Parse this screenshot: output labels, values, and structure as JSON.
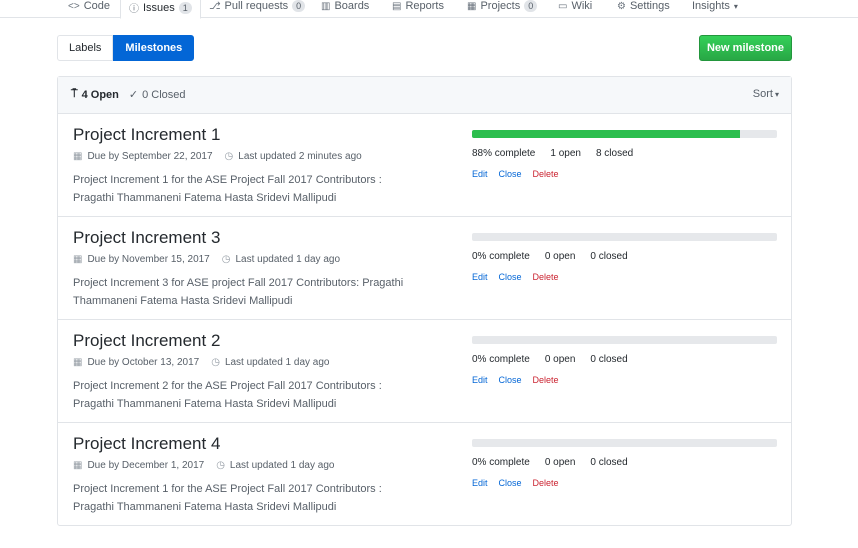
{
  "nav": {
    "tabs": [
      {
        "icon": "<>",
        "label": "Code",
        "counter": ""
      },
      {
        "icon": "ⓘ",
        "label": "Issues",
        "counter": "1"
      },
      {
        "icon": "⎇",
        "label": "Pull requests",
        "counter": "0"
      },
      {
        "icon": "▥",
        "label": "Boards",
        "counter": ""
      },
      {
        "icon": "▤",
        "label": "Reports",
        "counter": ""
      },
      {
        "icon": "▦",
        "label": "Projects",
        "counter": "0"
      },
      {
        "icon": "▭",
        "label": "Wiki",
        "counter": ""
      },
      {
        "icon": "⚙",
        "label": "Settings",
        "counter": ""
      },
      {
        "icon": "",
        "label": "Insights",
        "counter": ""
      }
    ]
  },
  "subnav": {
    "labels": "Labels",
    "milestones": "Milestones"
  },
  "new_milestone": "New milestone",
  "header": {
    "open": "4 Open",
    "closed": "0 Closed",
    "sort": "Sort"
  },
  "milestones": [
    {
      "title": "Project Increment 1",
      "due": "Due by September 22, 2017",
      "updated": "Last updated 2 minutes ago",
      "desc": "Project Increment 1 for the ASE Project Fall 2017 Contributors : Pragathi Thammaneni Fatema Hasta Sridevi Mallipudi",
      "progress": 88,
      "complete": "88% complete",
      "open": "1 open",
      "closed": "8 closed",
      "edit": "Edit",
      "close": "Close",
      "delete": "Delete"
    },
    {
      "title": "Project Increment 3",
      "due": "Due by November 15, 2017",
      "updated": "Last updated 1 day ago",
      "desc": "Project Increment 3 for ASE project Fall 2017 Contributors: Pragathi Thammaneni Fatema Hasta Sridevi Mallipudi",
      "progress": 0,
      "complete": "0% complete",
      "open": "0 open",
      "closed": "0 closed",
      "edit": "Edit",
      "close": "Close",
      "delete": "Delete"
    },
    {
      "title": "Project Increment 2",
      "due": "Due by October 13, 2017",
      "updated": "Last updated 1 day ago",
      "desc": "Project Increment 2 for the ASE Project Fall 2017 Contributors : Pragathi Thammaneni Fatema Hasta Sridevi Mallipudi",
      "progress": 0,
      "complete": "0% complete",
      "open": "0 open",
      "closed": "0 closed",
      "edit": "Edit",
      "close": "Close",
      "delete": "Delete"
    },
    {
      "title": "Project Increment 4",
      "due": "Due by December 1, 2017",
      "updated": "Last updated 1 day ago",
      "desc": "Project Increment 1 for the ASE Project Fall 2017 Contributors : Pragathi Thammaneni Fatema Hasta Sridevi Mallipudi",
      "progress": 0,
      "complete": "0% complete",
      "open": "0 open",
      "closed": "0 closed",
      "edit": "Edit",
      "close": "Close",
      "delete": "Delete"
    }
  ],
  "colors": {
    "accent": "#0366d6",
    "success": "#2cbe4e",
    "danger": "#cb2431"
  }
}
